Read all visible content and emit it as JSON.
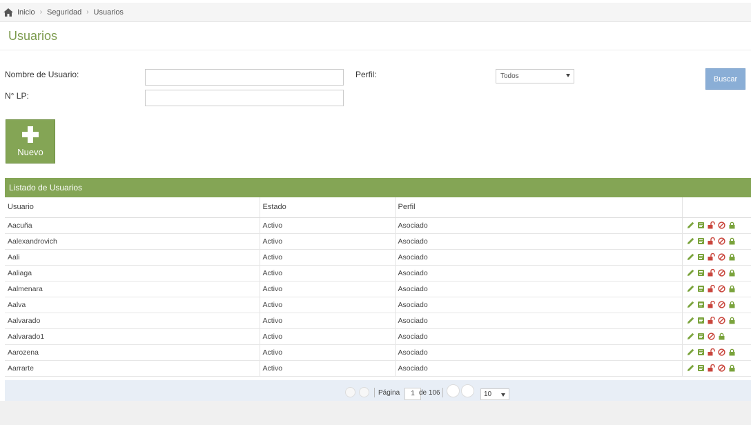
{
  "breadcrumb": {
    "home": "Inicio",
    "section": "Seguridad",
    "current": "Usuarios"
  },
  "page": {
    "title": "Usuarios"
  },
  "filters": {
    "username_label": "Nombre de Usuario:",
    "username_value": "",
    "lp_label": "N° LP:",
    "lp_value": "",
    "profile_label": "Perfil:",
    "profile_selected": "Todos",
    "search_button": "Buscar"
  },
  "new_button": {
    "label": "Nuevo"
  },
  "panel": {
    "title": "Listado de Usuarios"
  },
  "table": {
    "columns": [
      "Usuario",
      "Estado",
      "Perfil",
      ""
    ],
    "rows": [
      {
        "usuario": "Aacuña",
        "estado": "Activo",
        "perfil": "Asociado",
        "unlock": true
      },
      {
        "usuario": "Aalexandrovich",
        "estado": "Activo",
        "perfil": "Asociado",
        "unlock": true
      },
      {
        "usuario": "Aali",
        "estado": "Activo",
        "perfil": "Asociado",
        "unlock": true
      },
      {
        "usuario": "Aaliaga",
        "estado": "Activo",
        "perfil": "Asociado",
        "unlock": true
      },
      {
        "usuario": "Aalmenara",
        "estado": "Activo",
        "perfil": "Asociado",
        "unlock": true
      },
      {
        "usuario": "Aalva",
        "estado": "Activo",
        "perfil": "Asociado",
        "unlock": true
      },
      {
        "usuario": "Aalvarado",
        "estado": "Activo",
        "perfil": "Asociado",
        "unlock": true
      },
      {
        "usuario": "Aalvarado1",
        "estado": "Activo",
        "perfil": "Asociado",
        "unlock": false
      },
      {
        "usuario": "Aarozena",
        "estado": "Activo",
        "perfil": "Asociado",
        "unlock": true
      },
      {
        "usuario": "Aarrarte",
        "estado": "Activo",
        "perfil": "Asociado",
        "unlock": true
      }
    ],
    "row_icons": [
      "pencil-icon",
      "book-icon",
      "unlock-icon",
      "ban-icon",
      "lock-icon"
    ]
  },
  "pagination": {
    "page_label": "Página",
    "current_page": "1",
    "of_label": "de 106",
    "page_size": "10"
  },
  "colors": {
    "accent": "#84a555",
    "title": "#7b9a4c",
    "search_button": "#8aaed6",
    "icon_green": "#7aa33c",
    "icon_red": "#c9463d",
    "pager_bg": "#e8eef6"
  }
}
